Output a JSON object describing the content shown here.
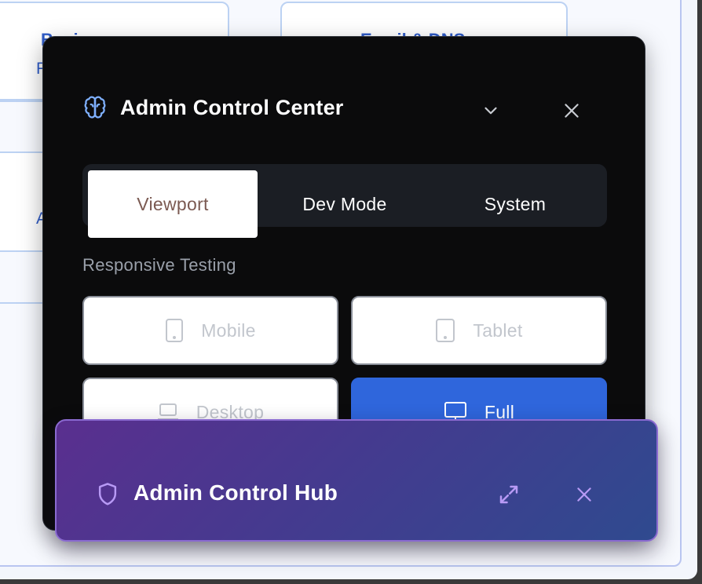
{
  "background": {
    "cards": [
      {
        "title": "Business",
        "subtitle": "F"
      },
      {
        "title": "Email & DNS"
      },
      {
        "subtitle": "A"
      }
    ]
  },
  "control_center": {
    "title": "Admin Control Center",
    "icons": {
      "brand": "brain-icon",
      "collapse": "chevron-down-icon",
      "close": "close-icon"
    },
    "tabs": [
      {
        "label": "Viewport",
        "active": true
      },
      {
        "label": "Dev Mode",
        "active": false
      },
      {
        "label": "System",
        "active": false
      }
    ],
    "section_label": "Responsive Testing",
    "devices": [
      {
        "label": "Mobile",
        "icon": "phone-icon",
        "active": false
      },
      {
        "label": "Tablet",
        "icon": "tablet-icon",
        "active": false
      },
      {
        "label": "Desktop",
        "icon": "laptop-icon",
        "active": false
      },
      {
        "label": "Full",
        "icon": "monitor-icon",
        "active": true
      }
    ]
  },
  "hub": {
    "title": "Admin Control Hub",
    "icons": {
      "brand": "shield-icon",
      "expand": "expand-icon",
      "close": "close-icon"
    }
  },
  "colors": {
    "accent_blue": "#2f66dc",
    "dialog_bg": "#0b0b0c",
    "hub_gradient_start": "#5a2f8f",
    "hub_gradient_end": "#2f4a8f",
    "active_tab_text": "#7b5a52"
  }
}
